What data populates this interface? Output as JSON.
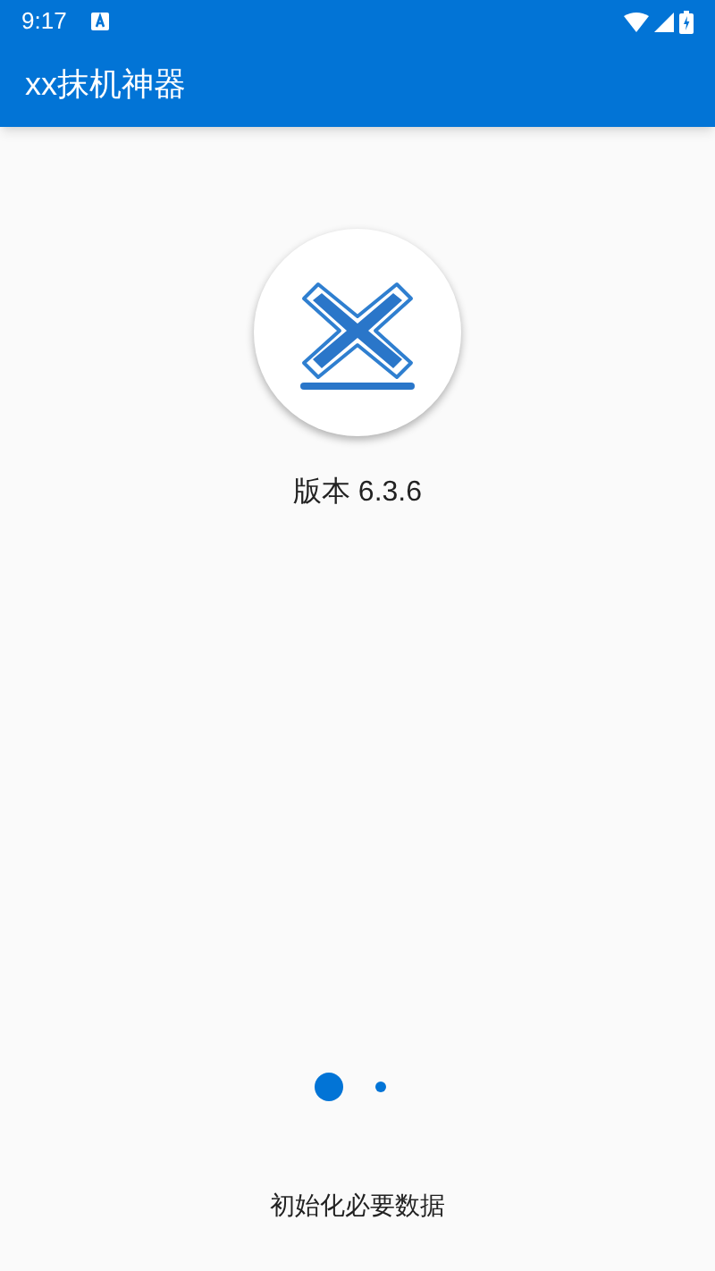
{
  "status_bar": {
    "time": "9:17"
  },
  "app_bar": {
    "title": "xx抹机神器"
  },
  "version": "版本 6.3.6",
  "message": "初始化必要数据"
}
